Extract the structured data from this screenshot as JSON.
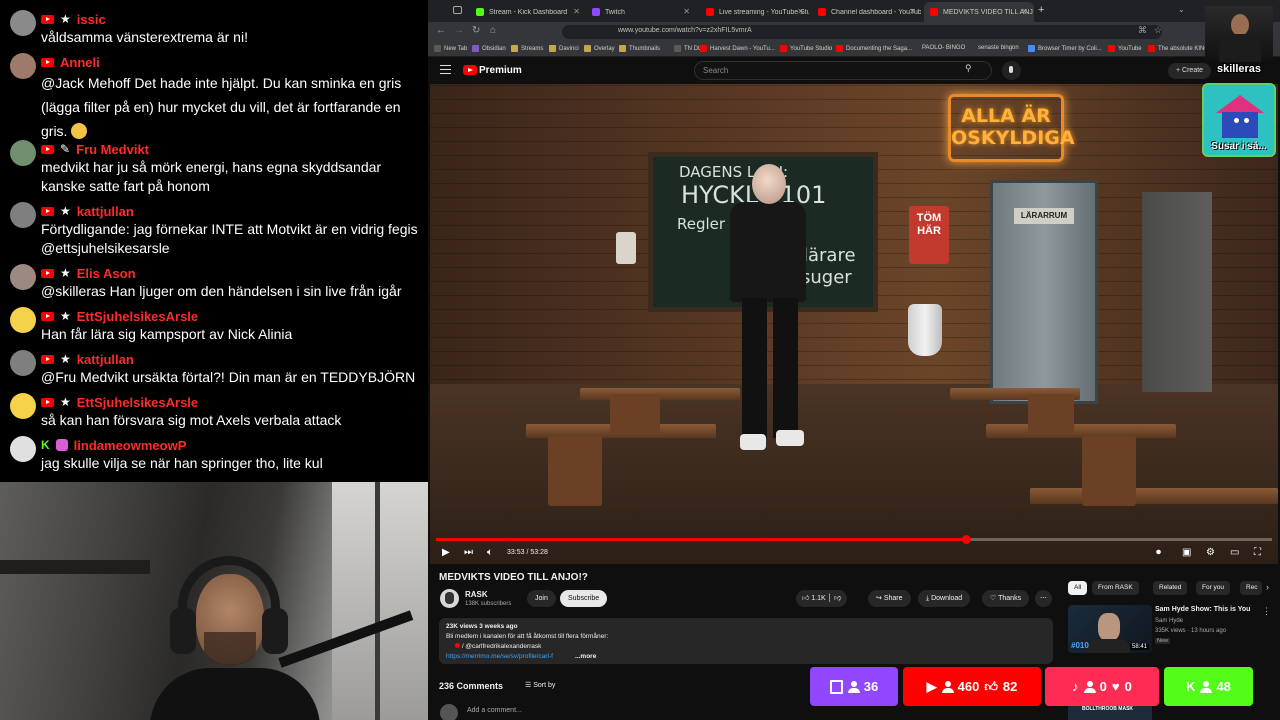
{
  "chat": {
    "messages": [
      {
        "user": "issic",
        "text": "våldsamma vänsterextrema är ni!",
        "avatar_color": "#8a8a8a"
      },
      {
        "user": "Anneli",
        "text": "@Jack Mehoff Det hade inte hjälpt. Du kan sminka en gris (lägga filter på en) hur mycket du vill, det är fortfarande en gris.",
        "emoji": "joy-emoji",
        "avatar_color": "#9d7a6a"
      },
      {
        "user": "Fru Medvikt",
        "text": "medvikt har ju så mörk energi, hans egna skyddsandar kanske satte fart på honom",
        "avatar_color": "#6f8f6f"
      },
      {
        "user": "kattjullan",
        "text": "Förtydligande: jag förnekar INTE att Motvikt är en vidrig fegis @ettsjuhelsikesarsle",
        "avatar_color": "#7f7f7f"
      },
      {
        "user": "Elis Ason",
        "text": "@skilleras Han ljuger om den händelsen i sin live från igår",
        "avatar_color": "#9a8a80"
      },
      {
        "user": "EttSjuhelsikesArsle",
        "text": "Han får lära sig kampsport av Nick Alinia",
        "avatar_color": "#f6d24a"
      },
      {
        "user": "kattjullan",
        "text": "@Fru Medvikt ursäkta förtal?! Din man är en TEDDYBJÖRN",
        "avatar_color": "#7f7f7f"
      },
      {
        "user": "EttSjuhelsikesArsle",
        "text": "så kan han försvara sig mot Axels verbala attack",
        "avatar_color": "#f6d24a"
      },
      {
        "user": "lindameowmeowP",
        "text": "jag skulle vilja se när han springer tho, lite kul",
        "avatar_color": "#e0e0e0"
      }
    ]
  },
  "browser": {
    "tabs": [
      {
        "title": "Stream - Kick Dashboard",
        "color": "#53fc18"
      },
      {
        "title": "Twitch",
        "color": "#9146ff"
      },
      {
        "title": "Live streaming - YouTube Studio",
        "color": "#ff0000"
      },
      {
        "title": "Channel dashboard - YouTube",
        "color": "#ff0000"
      },
      {
        "title": "MEDVIKTS VIDEO TILL ANJO!?",
        "color": "#ff0000"
      }
    ],
    "url": "www.youtube.com/watch?v=z2xhFIL5vmrA",
    "bookmarks": [
      {
        "label": "New Tab",
        "color": "#5a5a5a"
      },
      {
        "label": "Obsidian",
        "color": "#7c5cc4"
      },
      {
        "label": "Streams",
        "color": "#c9a64a"
      },
      {
        "label": "Davinci",
        "color": "#c9a64a"
      },
      {
        "label": "Overlay",
        "color": "#c9a64a"
      },
      {
        "label": "Thumbnails",
        "color": "#c9a64a"
      },
      {
        "label": "TN DL",
        "color": "#5a5a5a"
      },
      {
        "label": "Harvest Dawn - YouTu...",
        "color": "#ff0000"
      },
      {
        "label": "YouTube Studio",
        "color": "#ff0000"
      },
      {
        "label": "Documenting the Saga...",
        "color": "#ff0000"
      },
      {
        "label": "PAOLO- BINGO",
        "color": "#5a5a5a"
      },
      {
        "label": "senaste bingon",
        "color": "#5a5a5a"
      },
      {
        "label": "Browser Timer by Coli...",
        "color": "#4a8af4"
      },
      {
        "label": "YouTube",
        "color": "#ff0000"
      },
      {
        "label": "The absolute KING",
        "color": "#ff0000"
      }
    ]
  },
  "youtube": {
    "brand": "Premium",
    "search_placeholder": "Search",
    "create_label": "Create",
    "video": {
      "board_line1": "DAGENS L   ON:",
      "board_line2": "HYCKL   I 101",
      "board_line3": "Regler      elmoral",
      "board_line4": "lärare",
      "board_line5": "suger",
      "neon_sign": "ALLA ÄR OSKYLDIGA",
      "sign_tom": "TÖM HÄR",
      "door_label": "LÄRARRUM"
    },
    "player": {
      "time": "33:53 / 53:28",
      "progress": 0.634
    },
    "title": "MEDVIKTS VIDEO TILL ANJO!?",
    "channel": "RASK",
    "subscribers": "138K subscribers",
    "join_label": "Join",
    "subscribe_label": "Subscribe",
    "likes": "1.1K",
    "share_label": "Share",
    "download_label": "Download",
    "thanks_label": "Thanks",
    "description": {
      "meta": "23K views  3 weeks ago",
      "line1": "Bli medlem i kanalen för att få åtkomst till flera förmåner:",
      "line2": "/ @carlfredrikalexanderrask",
      "line3": "https://merrimo.me/se/sv/profile/carl-f",
      "more": "...more"
    },
    "comments_count": "236 Comments",
    "sort_label": "Sort by",
    "add_comment": "Add a comment...",
    "chips": [
      "All",
      "From RASK",
      "Related",
      "For you",
      "Rec"
    ],
    "related": [
      {
        "title": "Sam Hyde Show: This is You",
        "channel": "Sam Hyde",
        "meta": "335K views · 13 hours ago",
        "badge": "New",
        "duration": "58:41",
        "number": "#010"
      }
    ],
    "related_thumb2_text": "BOLLTHROOB MASK"
  },
  "overlay": {
    "streamer_name": "skilleras",
    "susar_label": "Susar i så...",
    "stats": [
      {
        "platform": "twitch",
        "viewers": "36",
        "color": "#9146ff"
      },
      {
        "platform": "youtube",
        "viewers": "460",
        "likes": "82",
        "color": "#ff0000"
      },
      {
        "platform": "tiktok",
        "viewers": "0",
        "likes": "0",
        "color": "#fe2c55"
      },
      {
        "platform": "kick",
        "viewers": "48",
        "color": "#53fc18"
      }
    ]
  }
}
